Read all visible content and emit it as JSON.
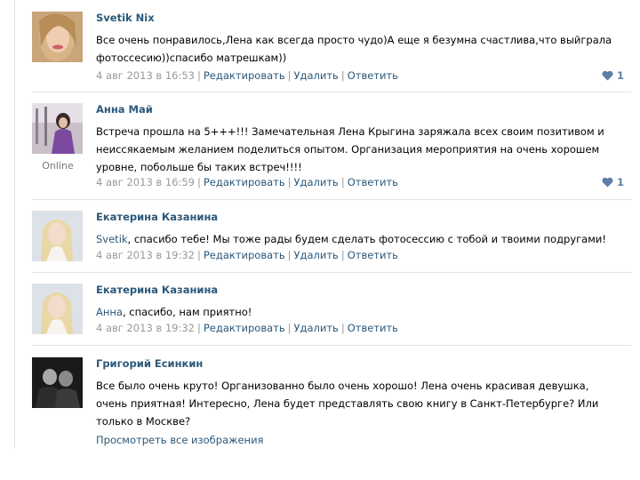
{
  "comments": [
    {
      "author": "Svetik Nix",
      "text": "Все очень понравилось,Лена как всегда просто чудо)А еще я безумна счастлива,что выйграла фотоссесию))спасибо матрешкам))",
      "date": "4 авг 2013 в 16:53",
      "edit": "Редактировать",
      "delete": "Удалить",
      "reply": "Ответить",
      "likes": "1",
      "like_icon": "heart-icon"
    },
    {
      "author": "Анна Май",
      "text": "Встреча прошла на 5+++!!! Замечательная Лена Крыгина заряжала всех своим позитивом и неиссякаемым желанием поделиться опытом. Организация мероприятия на очень хорошем уровне, побольше бы таких встреч!!!!",
      "online": "Online",
      "date": "4 авг 2013 в 16:59",
      "edit": "Редактировать",
      "delete": "Удалить",
      "reply": "Ответить",
      "likes": "1",
      "like_icon": "heart-icon"
    },
    {
      "author": "Екатерина Казанина",
      "mention": "Svetik",
      "text": ", спасибо тебе! Мы тоже рады будем сделать фотосессию с тобой и твоими подругами!",
      "date": "4 авг 2013 в 19:32",
      "edit": "Редактировать",
      "delete": "Удалить",
      "reply": "Ответить"
    },
    {
      "author": "Екатерина Казанина",
      "mention": "Анна",
      "text": ", спасибо, нам приятно!",
      "date": "4 авг 2013 в 19:32",
      "edit": "Редактировать",
      "delete": "Удалить",
      "reply": "Ответить"
    },
    {
      "author": "Григорий Есинкин",
      "text": "Все было очень круто! Организованно было очень хорошо! Лена очень красивая девушка, очень приятная! Интересно, Лена будет представлять свою книгу в Санкт-Петербурге? Или только в Москве?"
    }
  ],
  "view_all": "Просмотреть все изображения",
  "colors": {
    "link": "#2b587a",
    "meta": "#999999",
    "divider": "#dde3ea",
    "heart": "#5b7fa6"
  }
}
